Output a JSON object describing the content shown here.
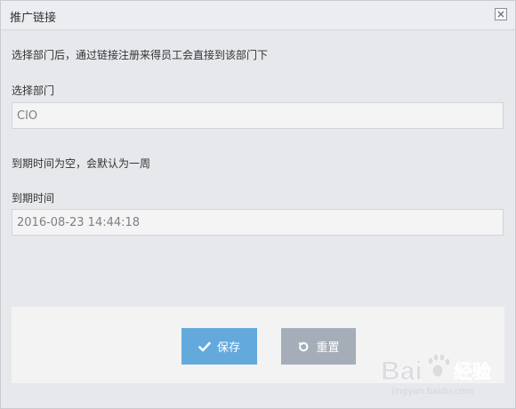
{
  "dialog": {
    "title": "推广链接",
    "close_icon": "close-icon"
  },
  "department_hint": "选择部门后，通过链接注册来得员工会直接到该部门下",
  "department_label": "选择部门",
  "department_value": "CIO",
  "expiry_hint": "到期时间为空，会默认为一周",
  "expiry_label": "到期时间",
  "expiry_value": "2016-08-23 14:44:18",
  "buttons": {
    "save": {
      "label": "保存",
      "icon": "check-icon",
      "color": "#64a9dc"
    },
    "reset": {
      "label": "重置",
      "icon": "undo-icon",
      "color": "#a5aeb8"
    }
  },
  "watermark": {
    "brand": "Bai",
    "brand2": "经验",
    "url": "jingyan.baidu.com"
  }
}
